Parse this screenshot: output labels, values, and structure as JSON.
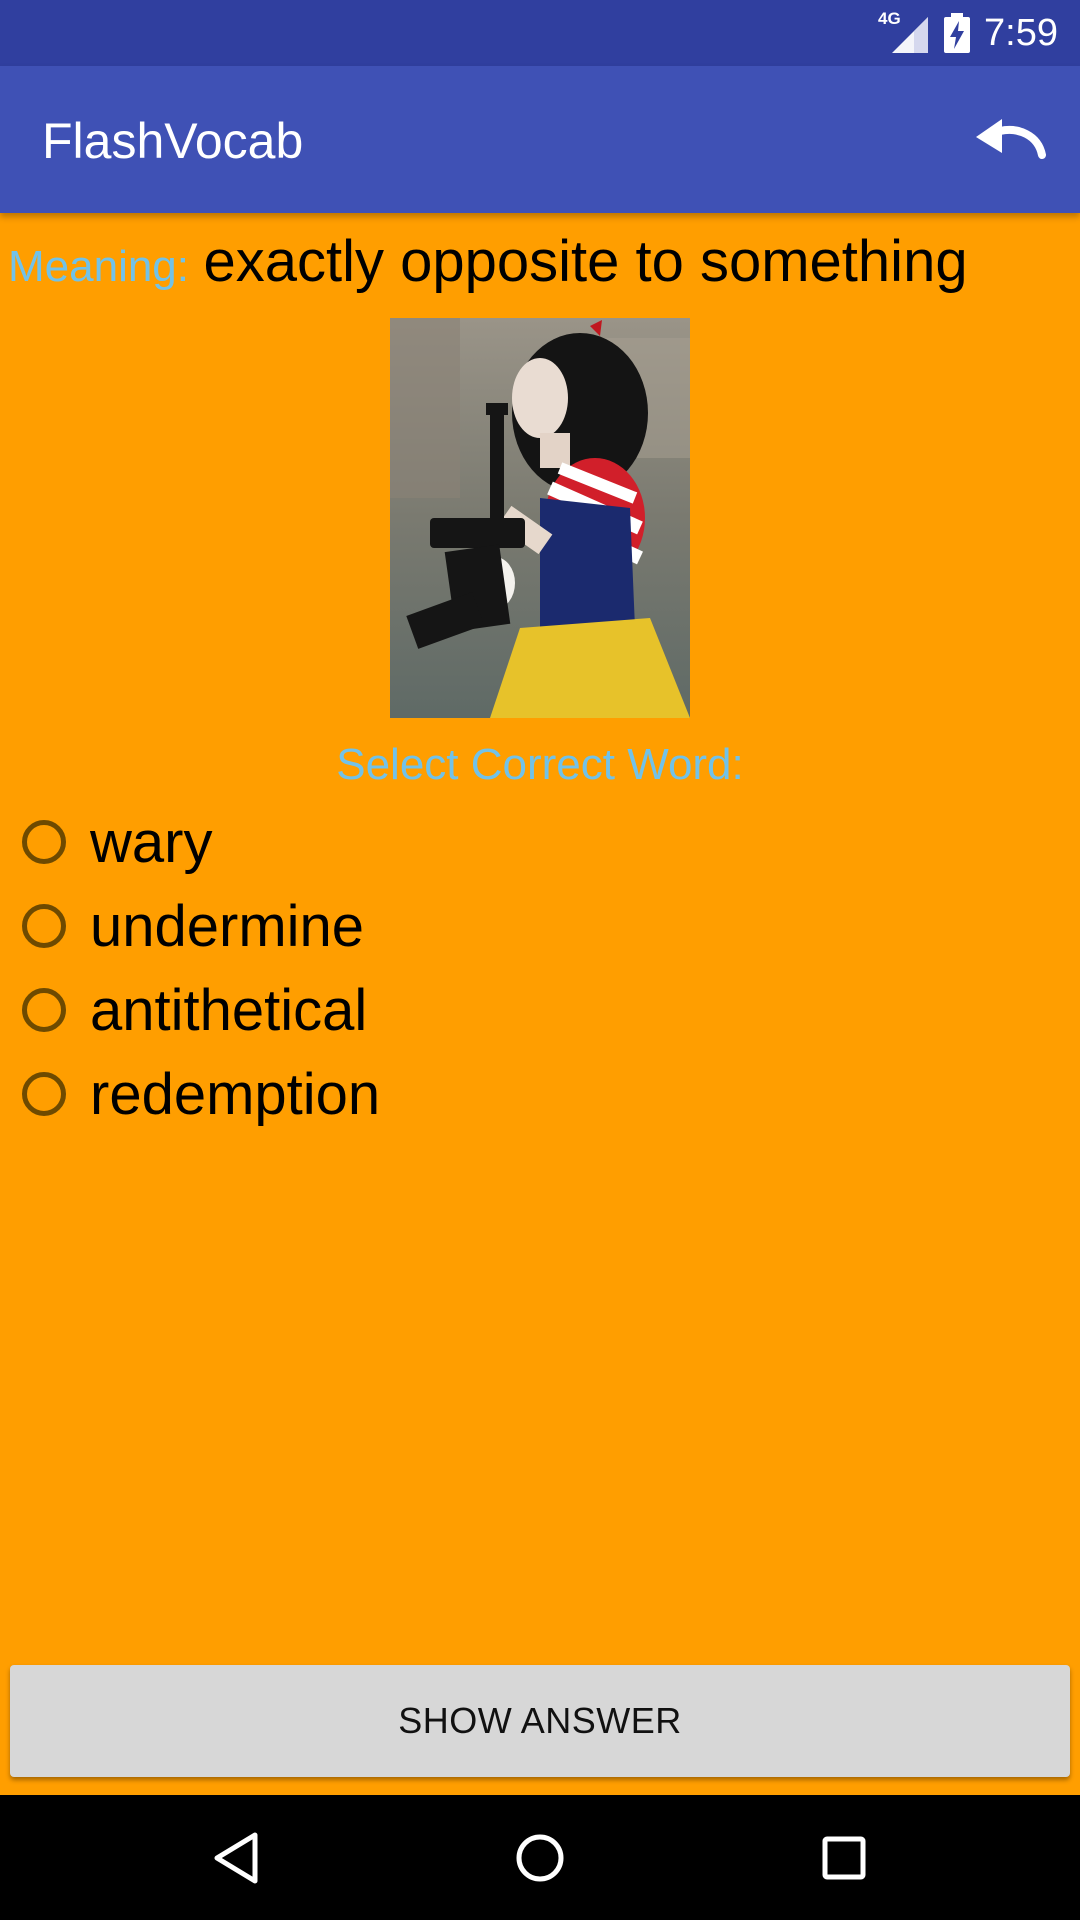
{
  "status_bar": {
    "network": "4G",
    "time": "7:59"
  },
  "app_bar": {
    "title": "FlashVocab",
    "undo_icon": "undo-icon"
  },
  "question": {
    "meaning_label": "Meaning:",
    "meaning_text": "exactly opposite to something",
    "prompt": "Select Correct Word:"
  },
  "options": [
    {
      "label": "wary",
      "selected": false
    },
    {
      "label": "undermine",
      "selected": false
    },
    {
      "label": "antithetical",
      "selected": false
    },
    {
      "label": "redemption",
      "selected": false
    }
  ],
  "actions": {
    "show_answer_label": "SHOW ANSWER"
  },
  "nav_bar": {
    "icons": [
      "back-icon",
      "home-icon",
      "recents-icon"
    ]
  },
  "colors": {
    "background": "#FF9E00",
    "app_bar": "#3F51B5",
    "status_bar": "#303F9F",
    "accent_text": "#72C2E8",
    "button": "#D7D7D7"
  }
}
